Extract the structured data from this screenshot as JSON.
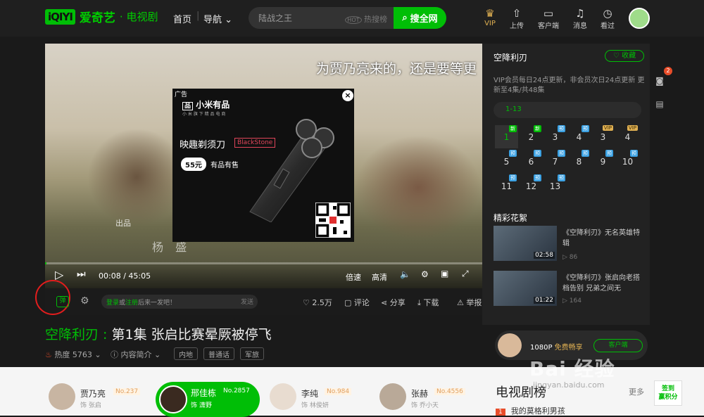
{
  "nav": {
    "logo_mark": "iQIYI",
    "logo_name": "爱奇艺",
    "channel": "· 电视剧",
    "home": "首页",
    "guide": "导航",
    "search_value": "陆战之王",
    "hot": "热搜榜",
    "search_btn": "搜全网",
    "icons": [
      {
        "label": "VIP",
        "icon": "crown-icon"
      },
      {
        "label": "上传",
        "icon": "upload-icon"
      },
      {
        "label": "客户端",
        "icon": "monitor-icon"
      },
      {
        "label": "消息",
        "icon": "bell-icon"
      },
      {
        "label": "看过",
        "icon": "history-icon"
      }
    ]
  },
  "player": {
    "subtitle": "为贾乃亮来的，还是要等更",
    "credit_small": "出品",
    "credit_big": "杨 盛",
    "time": "00:08 / 45:05",
    "progress": 0.003,
    "speed": "倍速",
    "quality": "高清"
  },
  "ad": {
    "tag": "广告",
    "brand": "小米有品",
    "slogan": "小 米 旗 下 精 品 电 商",
    "product": "映趣剃须刀",
    "model": "BlackStone",
    "price": "55元",
    "channel": "有品有售",
    "close": "×"
  },
  "bar": {
    "danmu_login": "登录",
    "danmu_or": "或",
    "danmu_register": "注册",
    "danmu_rest": "后来一发吧！",
    "send": "发送",
    "likes": "2.5万",
    "comment": "评论",
    "share": "分享",
    "download": "下载",
    "report": "举报"
  },
  "video": {
    "show": "空降利刃",
    "sep": " : ",
    "episode_title": "第1集 张启比赛晕厥被停飞",
    "heat_label": "热度",
    "heat": "5763",
    "intro": "内容简介",
    "tags": [
      "内地",
      "普通话",
      "军旅"
    ]
  },
  "side": {
    "title": "空降利刃",
    "collect": "收藏",
    "update": "VIP会员每日24点更新，非会员次日24点更新 更新至4集/共48集",
    "range": "1-13",
    "episodes": [
      {
        "n": "1",
        "badge": "新",
        "type": "new",
        "active": true
      },
      {
        "n": "2",
        "badge": "新",
        "type": "new"
      },
      {
        "n": "3",
        "badge": "预",
        "type": "pre"
      },
      {
        "n": "4",
        "badge": "预",
        "type": "pre"
      },
      {
        "n": "3",
        "badge": "VIP",
        "type": "vip"
      },
      {
        "n": "4",
        "badge": "VIP",
        "type": "vip"
      },
      {
        "n": "5",
        "badge": "预",
        "type": "pre"
      },
      {
        "n": "6",
        "badge": "预",
        "type": "pre"
      },
      {
        "n": "7",
        "badge": "预",
        "type": "pre"
      },
      {
        "n": "8",
        "badge": "预",
        "type": "pre"
      },
      {
        "n": "9",
        "badge": "预",
        "type": "pre"
      },
      {
        "n": "10",
        "badge": "预",
        "type": "pre"
      },
      {
        "n": "11",
        "badge": "预",
        "type": "pre"
      },
      {
        "n": "12",
        "badge": "预",
        "type": "pre"
      },
      {
        "n": "13",
        "badge": "预",
        "type": "pre"
      }
    ],
    "highlights_title": "精彩花絮",
    "clips": [
      {
        "title": "《空降利刃》无名英雄特辑",
        "duration": "02:58",
        "plays": "86"
      },
      {
        "title": "《空降利刃》张启向老搭档告别 兄弟之间无",
        "duration": "01:22",
        "plays": "164"
      }
    ],
    "promo_res": "1080P",
    "promo_free": "免费畅享",
    "promo_btn": "客户端",
    "badge_count": "2"
  },
  "cast": [
    {
      "name": "贾乃亮",
      "no": "No.237",
      "role": "饰 张启"
    },
    {
      "name": "邢佳栋",
      "no": "No.2857",
      "role": "饰 潇野"
    },
    {
      "name": "李纯",
      "no": "No.984",
      "role": "饰 林俊妍"
    },
    {
      "name": "张赫",
      "no": "No.4556",
      "role": "饰 乔小天"
    }
  ],
  "chart": {
    "title": "电视剧榜",
    "more": "更多",
    "rank1_n": "1",
    "rank1_title": "我的莫格利男孩"
  },
  "signin": {
    "l1": "签到",
    "l2": "赢积分"
  },
  "watermark": {
    "big": "Bai 经验",
    "small": "jingyan.baidu.com"
  }
}
